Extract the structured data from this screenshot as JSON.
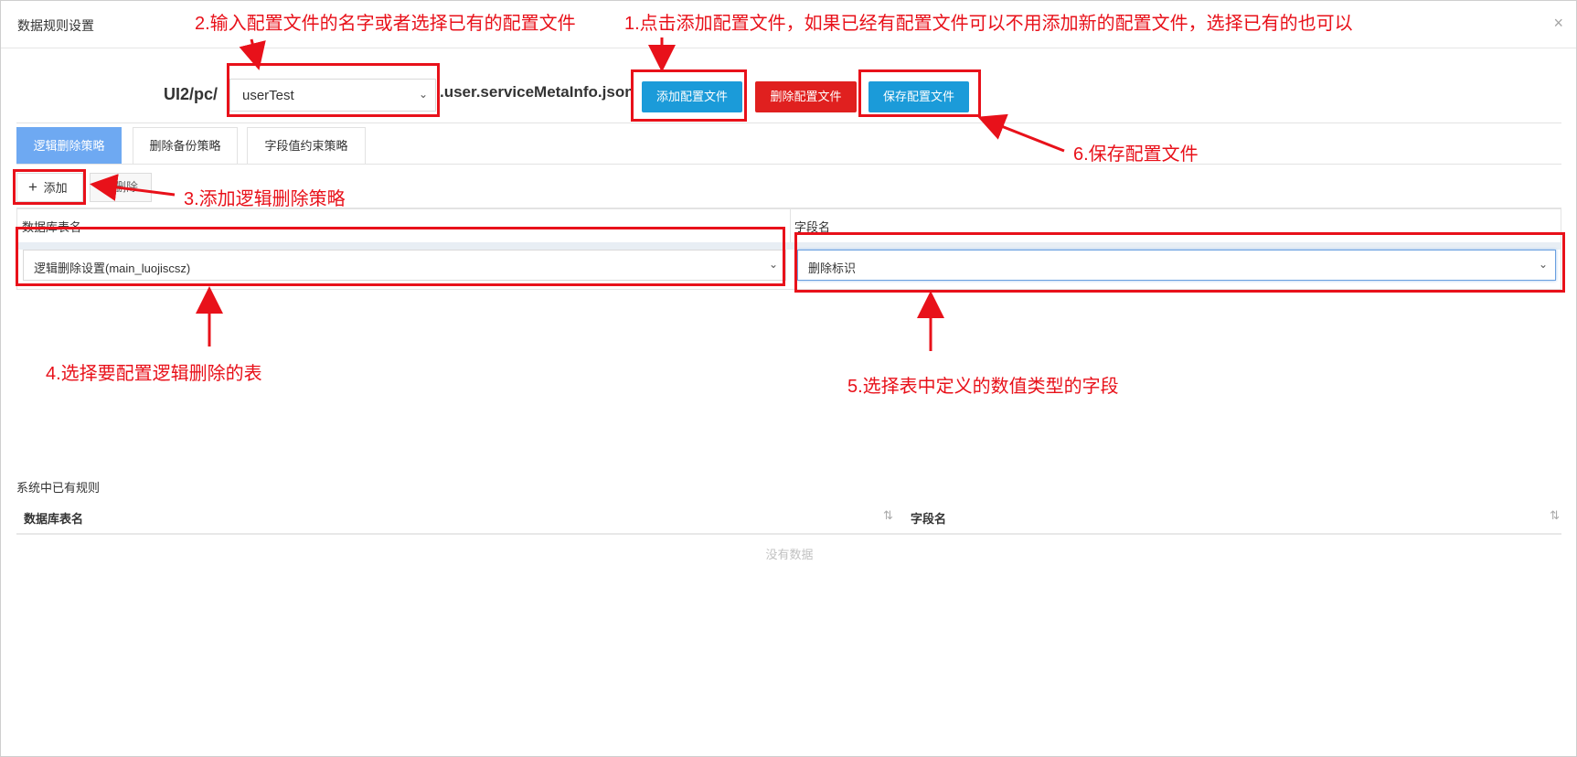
{
  "dialog": {
    "title": "数据规则设置",
    "close_label": "×"
  },
  "config": {
    "path_prefix": "UI2/pc/",
    "selected_value": "userTest",
    "path_suffix": ".user.serviceMetaInfo.json",
    "chevron": "⌄",
    "add_label": "添加配置文件",
    "delete_label": "删除配置文件",
    "save_label": "保存配置文件"
  },
  "tabs": [
    {
      "label": "逻辑删除策略",
      "active": true
    },
    {
      "label": "删除备份策略",
      "active": false
    },
    {
      "label": "字段值约束策略",
      "active": false
    }
  ],
  "toolbar": {
    "add_icon": "+",
    "add_label": "添加",
    "delete_label": "删除"
  },
  "grid": {
    "columns": [
      "数据库表名",
      "字段名"
    ],
    "table_value": "逻辑删除设置(main_luojiscsz)",
    "field_value": "删除标识"
  },
  "rules": {
    "title": "系统中已有规则",
    "columns": [
      "数据库表名",
      "字段名"
    ],
    "sort_icon": "⇅",
    "empty_text": "没有数据"
  },
  "annotations": {
    "step1": "1.点击添加配置文件，如果已经有配置文件可以不用添加新的配置文件，选择已有的也可以",
    "step2": "2.输入配置文件的名字或者选择已有的配置文件",
    "step3": "3.添加逻辑删除策略",
    "step4": "4.选择要配置逻辑删除的表",
    "step5": "5.选择表中定义的数值类型的字段",
    "step6": "6.保存配置文件",
    "color": "#e8111a"
  }
}
